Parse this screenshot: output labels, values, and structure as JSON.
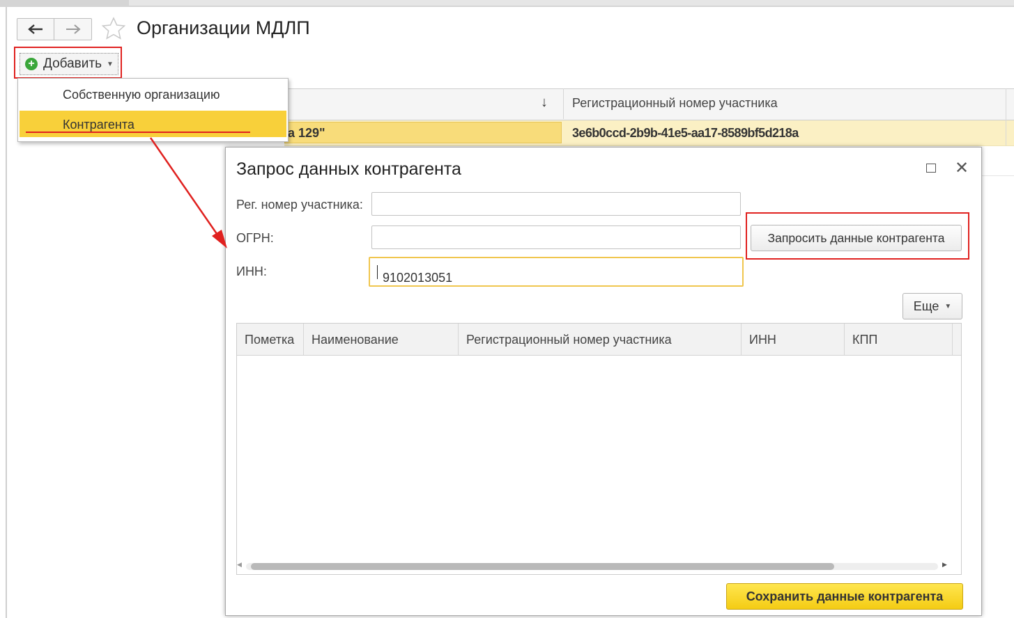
{
  "window": {
    "title": "Организации МДЛП"
  },
  "toolbar": {
    "add_label": "Добавить"
  },
  "add_menu": {
    "items": [
      "Собственную организацию",
      "Контрагента"
    ]
  },
  "bg_table": {
    "sort_indicator": "↓",
    "columns": [
      "",
      "Регистрационный номер участника"
    ],
    "selected_row": {
      "name_fragment": "а 129\"",
      "reg_number": "3e6b0ccd-2b9b-41e5-aa17-8589bf5d218a"
    }
  },
  "dialog": {
    "title": "Запрос данных контрагента",
    "fields": {
      "reg_label": "Рег. номер участника:",
      "reg_value": "",
      "ogrn_label": "ОГРН:",
      "ogrn_value": "",
      "inn_label": "ИНН:",
      "inn_value": "9102013051"
    },
    "request_button": "Запросить данные контрагента",
    "more_button": "Еще",
    "table": {
      "columns": [
        "Пометка",
        "Наименование",
        "Регистрационный номер участника",
        "ИНН",
        "КПП"
      ],
      "rows": []
    },
    "save_button": "Сохранить данные контрагента"
  },
  "colors": {
    "highlight_red": "#e0211f",
    "selected_yellow": "#f8d03a",
    "save_button_yellow": "#f4cc14"
  },
  "icons": [
    "back-arrow-icon",
    "forward-arrow-icon",
    "favorite-star-icon",
    "add-plus-icon",
    "dropdown-caret-icon",
    "maximize-icon",
    "close-icon",
    "scroll-left-icon",
    "scroll-right-icon"
  ]
}
